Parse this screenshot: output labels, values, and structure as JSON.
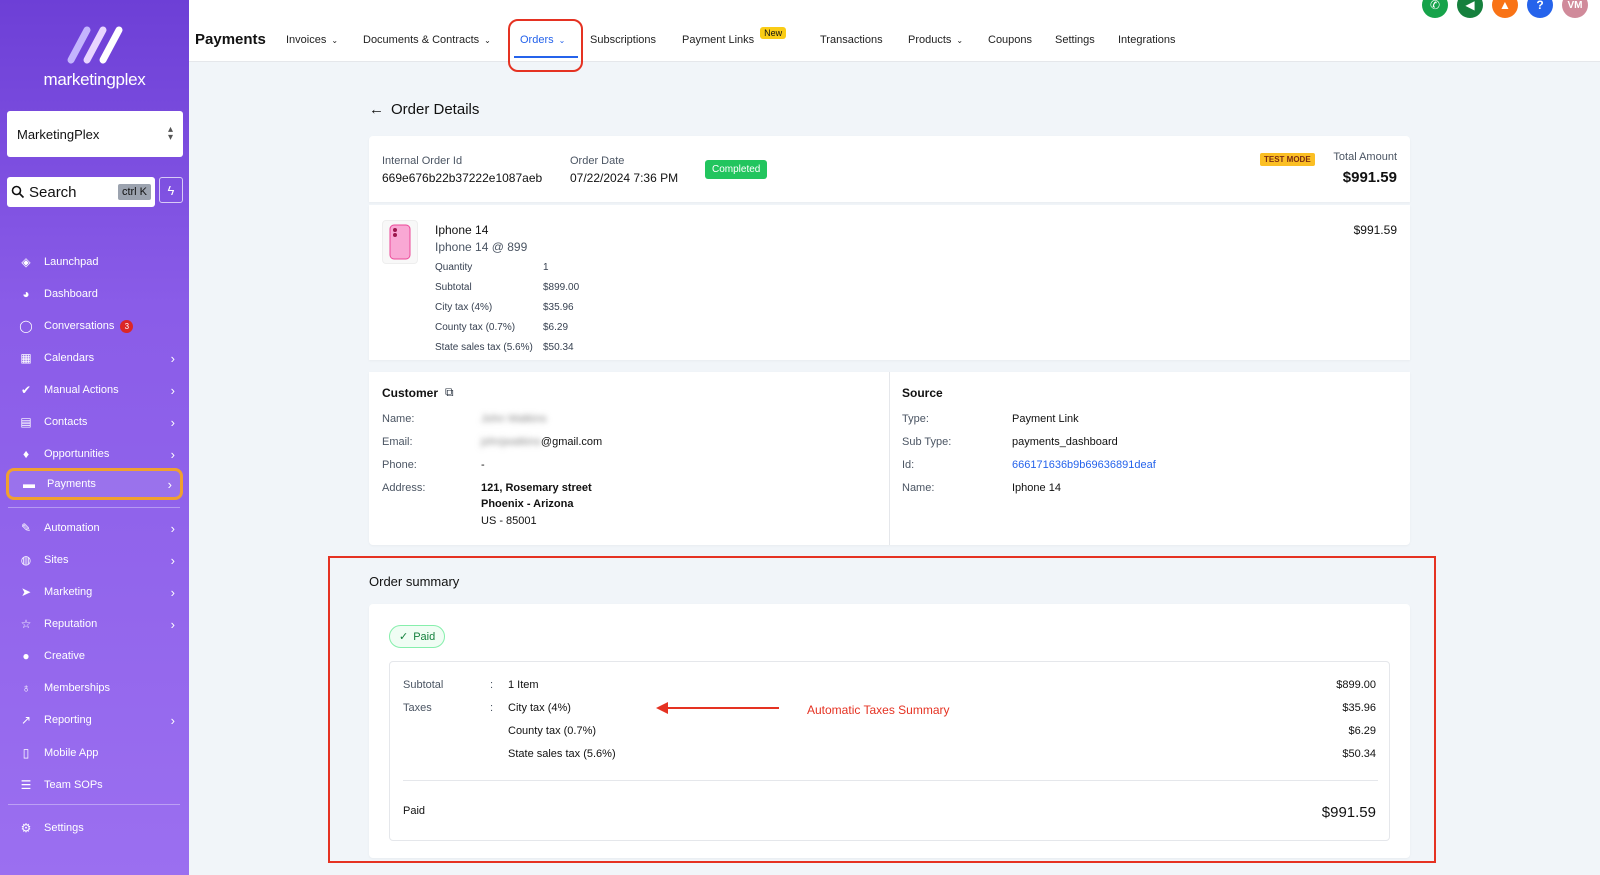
{
  "sidebar": {
    "brand": "marketingplex",
    "account": "MarketingPlex",
    "search_label": "Search",
    "search_shortcut": "ctrl K",
    "items": [
      {
        "label": "Launchpad",
        "icon": "rocket-icon"
      },
      {
        "label": "Dashboard",
        "icon": "gauge-icon"
      },
      {
        "label": "Conversations",
        "icon": "chat-icon",
        "badge": "3"
      },
      {
        "label": "Calendars",
        "icon": "calendar-icon"
      },
      {
        "label": "Manual Actions",
        "icon": "check-circle-icon"
      },
      {
        "label": "Contacts",
        "icon": "contacts-icon"
      },
      {
        "label": "Opportunities",
        "icon": "funnel-icon"
      },
      {
        "label": "Payments",
        "icon": "card-icon"
      },
      {
        "label": "Automation",
        "icon": "wand-icon"
      },
      {
        "label": "Sites",
        "icon": "globe-icon"
      },
      {
        "label": "Marketing",
        "icon": "send-icon"
      },
      {
        "label": "Reputation",
        "icon": "star-icon"
      },
      {
        "label": "Creative",
        "icon": "palette-icon"
      },
      {
        "label": "Memberships",
        "icon": "award-icon"
      },
      {
        "label": "Reporting",
        "icon": "chart-icon"
      },
      {
        "label": "Mobile App",
        "icon": "phone-icon"
      },
      {
        "label": "Team SOPs",
        "icon": "list-icon"
      },
      {
        "label": "Settings",
        "icon": "gear-icon"
      }
    ]
  },
  "topbar": {
    "title": "Payments",
    "tabs": [
      {
        "label": "Invoices"
      },
      {
        "label": "Documents & Contracts"
      },
      {
        "label": "Orders"
      },
      {
        "label": "Subscriptions"
      },
      {
        "label": "Payment Links",
        "badge": "New"
      },
      {
        "label": "Transactions"
      },
      {
        "label": "Products"
      },
      {
        "label": "Coupons"
      },
      {
        "label": "Settings"
      },
      {
        "label": "Integrations"
      }
    ],
    "avatar_initials": "VM",
    "help_glyph": "?"
  },
  "order": {
    "back_title": "Order Details",
    "internal_id_label": "Internal Order Id",
    "internal_id": "669e676b22b37222e1087aeb",
    "date_label": "Order Date",
    "date": "07/22/2024 7:36 PM",
    "status": "Completed",
    "test_mode": "TEST MODE",
    "total_label": "Total Amount",
    "total": "$991.59",
    "item": {
      "name": "Iphone 14",
      "variant": "Iphone 14 @ 899",
      "price": "$991.59",
      "rows": [
        {
          "label": "Quantity",
          "value": "1"
        },
        {
          "label": "Subtotal",
          "value": "$899.00"
        },
        {
          "label": "City tax (4%)",
          "value": "$35.96"
        },
        {
          "label": "County tax (0.7%)",
          "value": "$6.29"
        },
        {
          "label": "State sales tax (5.6%)",
          "value": "$50.34"
        }
      ]
    },
    "customer": {
      "heading": "Customer",
      "name_label": "Name:",
      "name": "John Watkins",
      "email_label": "Email:",
      "email_hidden": "johnjwatkins",
      "email_domain": "@gmail.com",
      "phone_label": "Phone:",
      "phone": "-",
      "address_label": "Address:",
      "address_line1": "121, Rosemary street",
      "address_line2": "Phoenix - Arizona",
      "address_line3": "US - 85001"
    },
    "source": {
      "heading": "Source",
      "type_label": "Type:",
      "type": "Payment Link",
      "subtype_label": "Sub Type:",
      "subtype": "payments_dashboard",
      "id_label": "Id:",
      "id": "666171636b9b69636891deaf",
      "name_label": "Name:",
      "name": "Iphone 14"
    }
  },
  "summary": {
    "heading": "Order summary",
    "paid_pill": "Paid",
    "subtotal_label": "Subtotal",
    "subtotal_desc": "1 Item",
    "subtotal_value": "$899.00",
    "taxes_label": "Taxes",
    "colon": ":",
    "taxes": [
      {
        "label": "City tax (4%)",
        "value": "$35.96"
      },
      {
        "label": "County tax (0.7%)",
        "value": "$6.29"
      },
      {
        "label": "State sales tax (5.6%)",
        "value": "$50.34"
      }
    ],
    "paid_label": "Paid",
    "paid_value": "$991.59",
    "annotation": "Automatic Taxes Summary"
  },
  "colors": {
    "sidebar": "#7c4ddf",
    "accent": "#2563eb",
    "highlight_red": "#e53222",
    "highlight_orange": "#f0a030",
    "success": "#22c55e"
  }
}
